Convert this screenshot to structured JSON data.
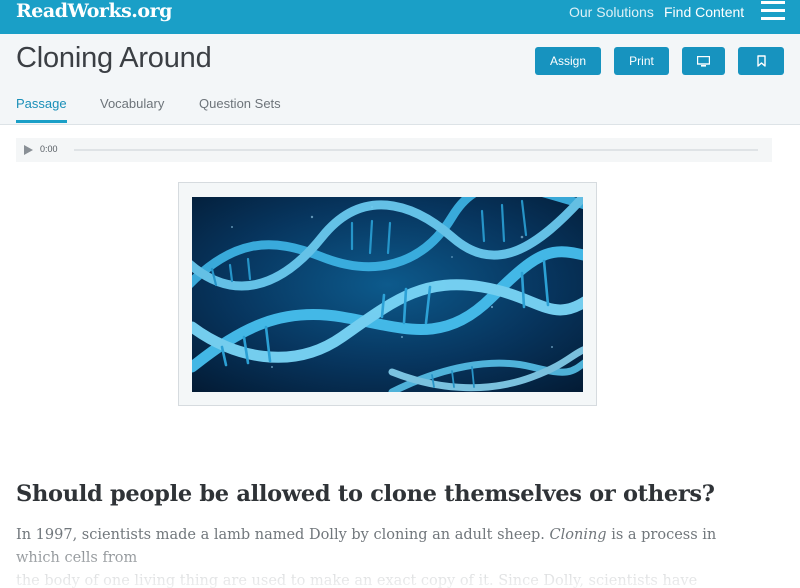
{
  "topbar": {
    "logo": "ReadWorks.org",
    "nav": {
      "solutions": "Our Solutions",
      "find_content": "Find Content"
    },
    "menu_icon": "hamburger-menu-icon"
  },
  "header": {
    "title": "Cloning Around",
    "buttons": {
      "assign": "Assign",
      "print": "Print",
      "present_icon": "monitor-icon",
      "bookmark_icon": "bookmark-icon"
    },
    "tabs": [
      "Passage",
      "Vocabulary",
      "Question Sets"
    ],
    "active_tab": "Passage"
  },
  "audio": {
    "time": "0:00",
    "progress": 0
  },
  "image": {
    "subject": "dna-double-helix"
  },
  "article": {
    "headline": "Should people be allowed to clone themselves or others?",
    "p1_before": "In 1997, scientists made a lamb named Dolly by cloning an adult sheep. ",
    "p1_em": "Cloning",
    "p1_after": " is a process in which cells from",
    "p1_line2": "the body of one living thing are used to make an exact copy of it. Since Dolly, scientists have cloned..."
  },
  "colors": {
    "brand": "#1a9fc7",
    "button": "#1793bf",
    "title": "#3b3f44",
    "header_bg": "#f3f6f8"
  }
}
